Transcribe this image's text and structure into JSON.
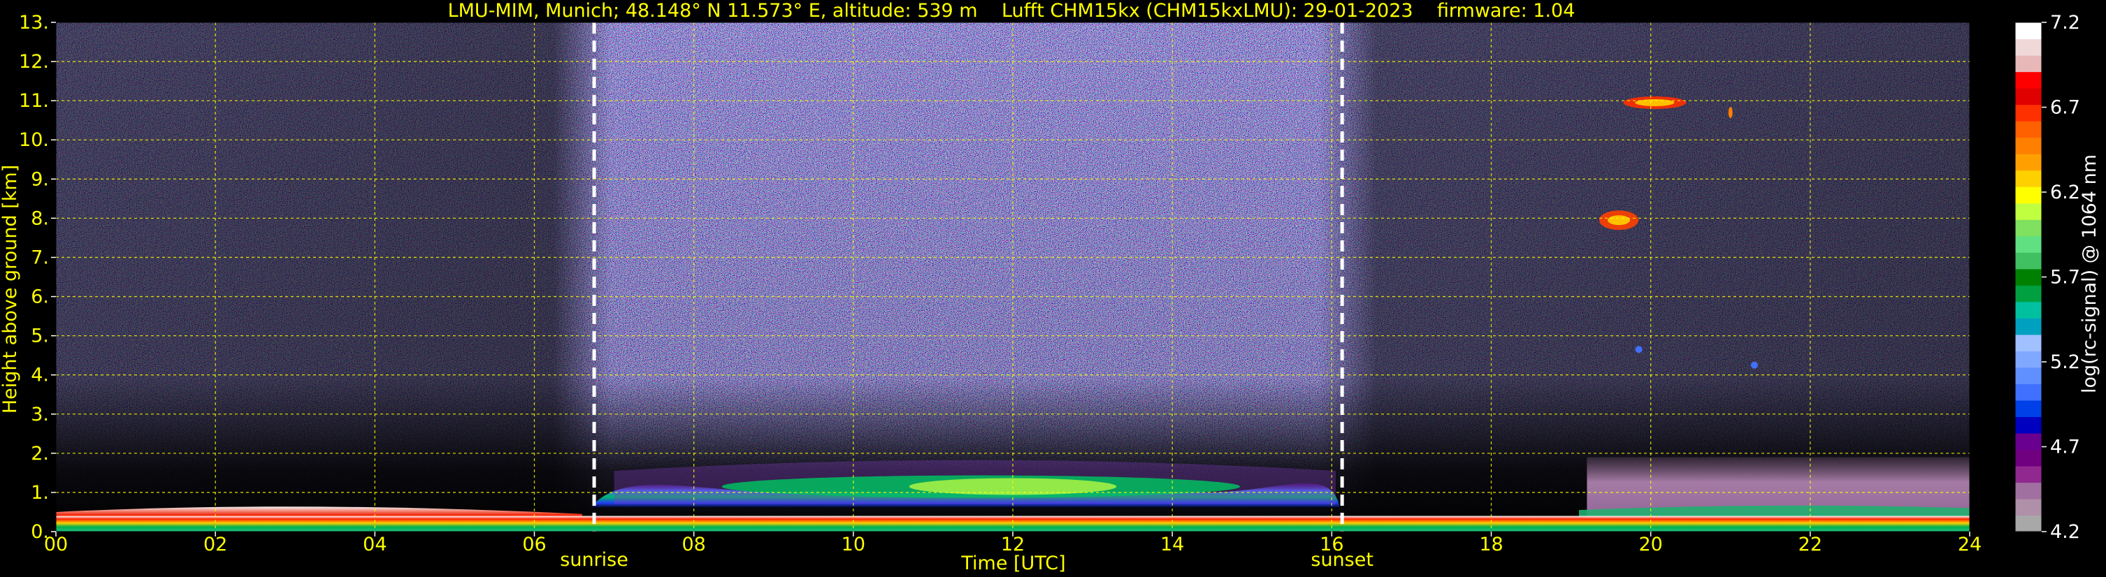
{
  "chart_data": {
    "type": "heatmap",
    "title": "LMU-MIM, Munich; 48.148° N 11.573° E, altitude: 539 m    Lufft CHM15kx (CHM15kxLMU): 29-01-2023    firmware: 1.04",
    "xlabel": "Time [UTC]",
    "ylabel": "Height above ground [km]",
    "xlim": [
      0,
      24
    ],
    "ylim": [
      0,
      13
    ],
    "xticks": [
      0,
      2,
      4,
      6,
      8,
      10,
      12,
      14,
      16,
      18,
      20,
      22,
      24
    ],
    "xtick_labels": [
      "00",
      "02",
      "04",
      "06",
      "08",
      "10",
      "12",
      "14",
      "16",
      "18",
      "20",
      "22",
      "24"
    ],
    "yticks": [
      0,
      1,
      2,
      3,
      4,
      5,
      6,
      7,
      8,
      9,
      10,
      11,
      12,
      13
    ],
    "ytick_labels": [
      "0.",
      "1.",
      "2.",
      "3.",
      "4.",
      "5.",
      "6.",
      "7.",
      "8.",
      "9.",
      "10.",
      "11.",
      "12.",
      "13."
    ],
    "grid": true,
    "grid_color": "#ffff00",
    "background_color": "#000000",
    "markers": [
      {
        "label": "sunrise",
        "x": 6.75
      },
      {
        "label": "sunset",
        "x": 16.13
      }
    ],
    "colorbar": {
      "label": "log(rc-signal) @ 1064 nm",
      "min": 4.2,
      "max": 7.2,
      "ticks": [
        4.2,
        4.7,
        5.2,
        5.7,
        6.2,
        6.7,
        7.2
      ],
      "tick_labels": [
        "4.2",
        "4.7",
        "5.2",
        "5.7",
        "6.2",
        "6.7",
        "7.2"
      ],
      "colors": [
        "#a8a8a8",
        "#b090a8",
        "#a070a0",
        "#902890",
        "#700080",
        "#6a0090",
        "#0000c0",
        "#0040e8",
        "#4070ff",
        "#6090ff",
        "#80a8ff",
        "#a0c0ff",
        "#00a0c0",
        "#00c0a0",
        "#00a040",
        "#008000",
        "#40c060",
        "#60e080",
        "#80e060",
        "#c0ff40",
        "#ffff00",
        "#ffd000",
        "#ffa000",
        "#ff8000",
        "#ff6000",
        "#ff3000",
        "#e00000",
        "#ff0000",
        "#e8b8b8",
        "#f0d8d8",
        "#ffffff"
      ]
    }
  }
}
